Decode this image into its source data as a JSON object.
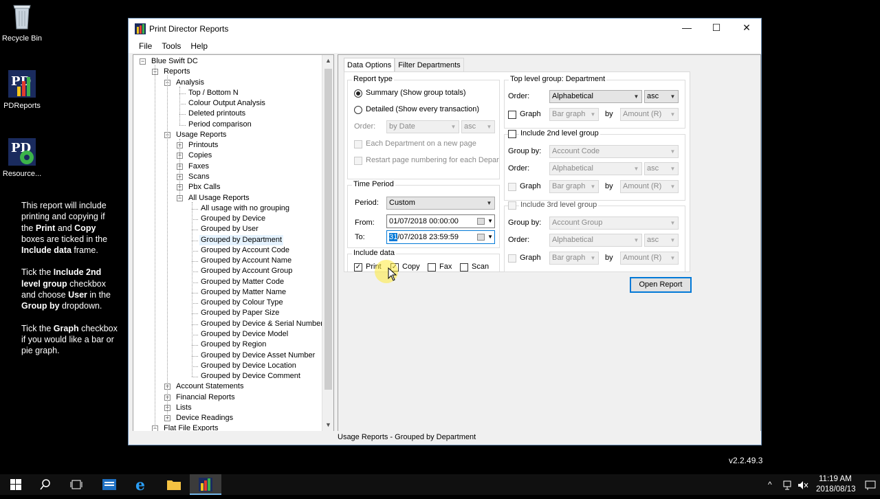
{
  "desktop": {
    "icons": [
      {
        "label": "Recycle Bin",
        "icon": "recycle-bin-icon"
      },
      {
        "label": "PDReports",
        "icon": "pdreports-icon"
      },
      {
        "label": "Resource...",
        "icon": "resource-icon"
      }
    ],
    "note": {
      "p1_a": "This report will include printing and copying if the ",
      "p1_b": "Print",
      "p1_c": " and ",
      "p1_d": "Copy",
      "p1_e": " boxes are ticked in the ",
      "p1_f": "Include data",
      "p1_g": " frame.",
      "p2_a": "Tick the ",
      "p2_b": "Include 2nd level group",
      "p2_c": " checkbox and choose ",
      "p2_d": "User",
      "p2_e": " in the ",
      "p2_f": "Group by",
      "p2_g": " dropdown.",
      "p3_a": "Tick the ",
      "p3_b": "Graph",
      "p3_c": " checkbox if you would like a bar or pie graph."
    },
    "version": "v2.2.49.3"
  },
  "window": {
    "title": "Print Director Reports",
    "controls": {
      "minimize": "—",
      "maximize": "☐",
      "close": "✕"
    },
    "menu": [
      "File",
      "Tools",
      "Help"
    ],
    "status": "Usage Reports - Grouped by Department"
  },
  "tree": [
    {
      "label": "Blue Swift DC"
    },
    {
      "label": "Reports"
    },
    {
      "label": "Analysis"
    },
    {
      "label": "Top / Bottom N"
    },
    {
      "label": "Colour Output Analysis"
    },
    {
      "label": "Deleted printouts"
    },
    {
      "label": "Period comparison"
    },
    {
      "label": "Usage Reports"
    },
    {
      "label": "Printouts"
    },
    {
      "label": "Copies"
    },
    {
      "label": "Faxes"
    },
    {
      "label": "Scans"
    },
    {
      "label": "Pbx Calls"
    },
    {
      "label": "All Usage Reports"
    },
    {
      "label": "All usage with no grouping"
    },
    {
      "label": "Grouped by Device"
    },
    {
      "label": "Grouped by User"
    },
    {
      "label": "Grouped by Department"
    },
    {
      "label": "Grouped by Account Code"
    },
    {
      "label": "Grouped by Account Name"
    },
    {
      "label": "Grouped by Account Group"
    },
    {
      "label": "Grouped by Matter Code"
    },
    {
      "label": "Grouped by Matter Name"
    },
    {
      "label": "Grouped by Colour Type"
    },
    {
      "label": "Grouped by Paper Size"
    },
    {
      "label": "Grouped by Device & Serial Number"
    },
    {
      "label": "Grouped by Device Model"
    },
    {
      "label": "Grouped by Region"
    },
    {
      "label": "Grouped by Device Asset Number"
    },
    {
      "label": "Grouped by Device Location"
    },
    {
      "label": "Grouped by Device Comment"
    },
    {
      "label": "Account Statements"
    },
    {
      "label": "Financial Reports"
    },
    {
      "label": "Lists"
    },
    {
      "label": "Device Readings"
    },
    {
      "label": "Flat File Exports"
    }
  ],
  "tabs": {
    "data_options": "Data Options",
    "filter_departments": "Filter Departments"
  },
  "report_type": {
    "legend": "Report type",
    "summary": "Summary (Show group totals)",
    "detailed": "Detailed (Show every transaction)",
    "order_label": "Order:",
    "order_value": "by Date",
    "order_dir": "asc",
    "each_dept": "Each Department on a new page",
    "restart": "Restart page numbering for each Department"
  },
  "time_period": {
    "legend": "Time Period",
    "period_label": "Period:",
    "period_value": "Custom",
    "from_label": "From:",
    "from_value": "01/07/2018 00:00:00",
    "to_label": "To:",
    "to_day": "31",
    "to_rest": "/07/2018 23:59:59"
  },
  "include_data": {
    "legend": "Include data",
    "print": "Print",
    "copy": "Copy",
    "fax": "Fax",
    "scan": "Scan"
  },
  "top_group": {
    "legend": "Top level group: Department",
    "order_label": "Order:",
    "order_value": "Alphabetical",
    "order_dir": "asc",
    "graph_label": "Graph",
    "graph_type": "Bar graph",
    "by": "by",
    "graph_by": "Amount (R)"
  },
  "second_group": {
    "legend": "Include 2nd level group",
    "group_by_label": "Group by:",
    "group_by_value": "Account Code",
    "order_label": "Order:",
    "order_value": "Alphabetical",
    "order_dir": "asc",
    "graph_label": "Graph",
    "graph_type": "Bar graph",
    "by": "by",
    "graph_by": "Amount (R)"
  },
  "third_group": {
    "legend": "Include 3rd level group",
    "group_by_label": "Group by:",
    "group_by_value": "Account Group",
    "order_label": "Order:",
    "order_value": "Alphabetical",
    "order_dir": "asc",
    "graph_label": "Graph",
    "graph_type": "Bar graph",
    "by": "by",
    "graph_by": "Amount (R)"
  },
  "open_report": "Open Report",
  "taskbar": {
    "time": "11:19 AM",
    "date": "2018/08/13"
  }
}
